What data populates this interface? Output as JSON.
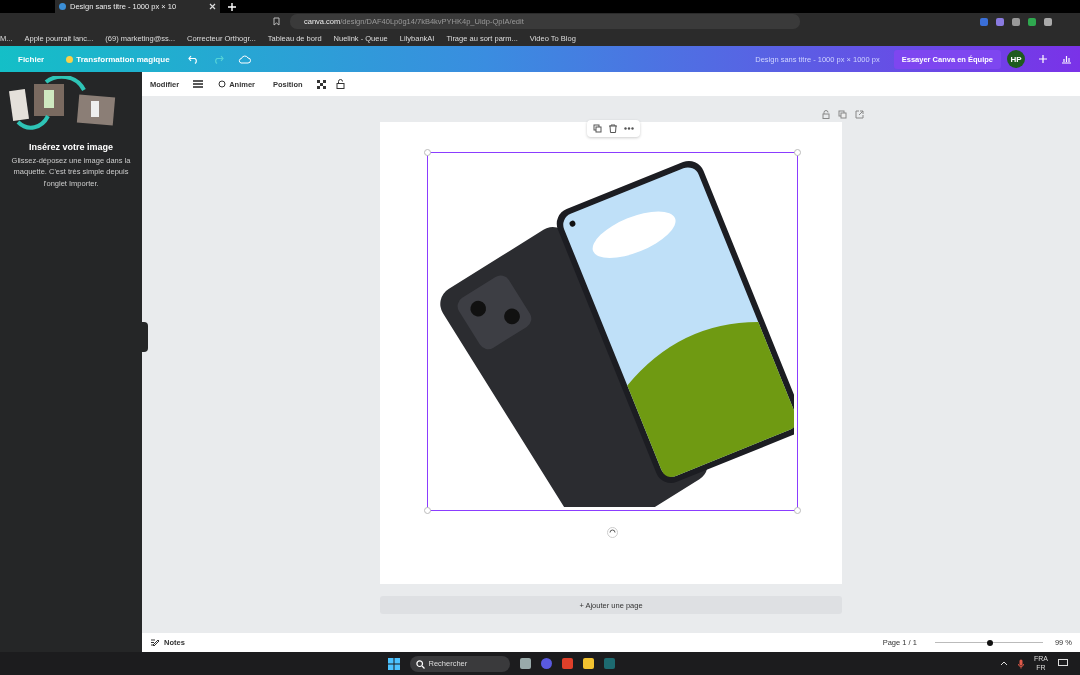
{
  "browser": {
    "tab_title": "Design sans titre - 1000 px × 10",
    "url_host": "canva.com",
    "url_path": "/design/DAF40Lp0g14/7kB4kvPYHK4p_Uidp-QpIA/edit",
    "bookmarks": [
      "M...",
      "Apple pourrait lanc...",
      "(69) marketing@ss...",
      "Correcteur Orthogr...",
      "Tableau de bord",
      "Nuelink - Queue",
      "LilybankAI",
      "Tirage au sort parm...",
      "Video To Blog"
    ]
  },
  "header": {
    "menu": "Fichier",
    "magic": "Transformation magique",
    "design_title": "Design sans titre - 1000 px × 1000 px",
    "try_button": "Essayer Canva en Équipe",
    "avatar": "HP"
  },
  "toolbar": [
    "Modifier",
    "Animer",
    "Position"
  ],
  "side_panel": {
    "title": "Insérez votre image",
    "description": "Glissez-déposez une image dans la maquette. C'est très simple depuis l'onglet Importer."
  },
  "canvas": {
    "add_page": "+ Ajouter une page"
  },
  "footer": {
    "notes": "Notes",
    "page": "Page 1 / 1",
    "zoom": {
      "level": 0.51,
      "reading": "99 %"
    }
  },
  "taskbar": {
    "search_placeholder": "Rechercher",
    "language": "FRA",
    "keyboard": "FR"
  }
}
